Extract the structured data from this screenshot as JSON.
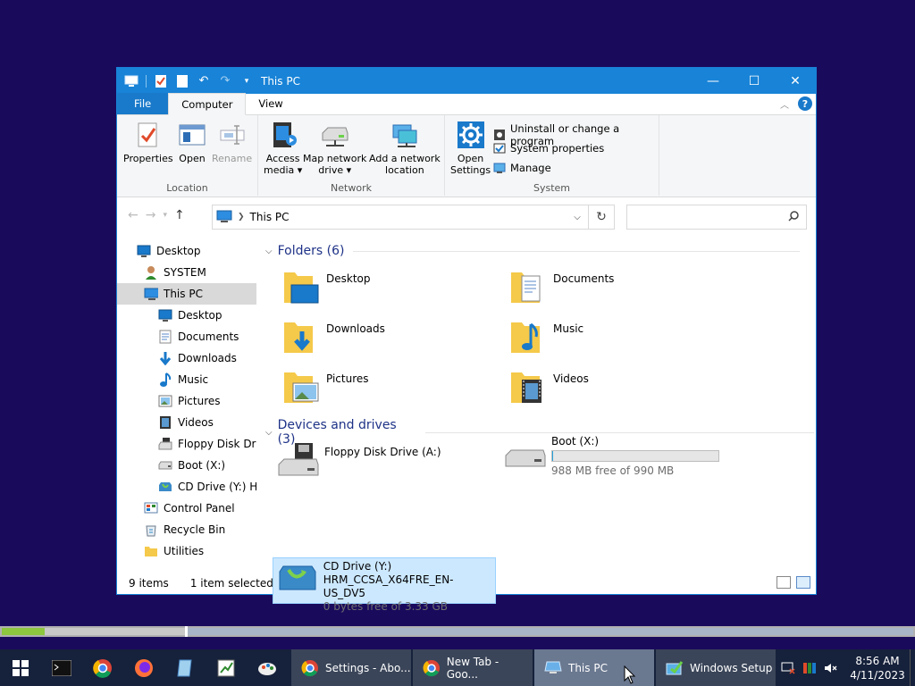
{
  "window": {
    "title": "This PC",
    "controls": {
      "minimize": "—",
      "maximize": "☐",
      "close": "✕"
    }
  },
  "ribbon": {
    "tabs": [
      "File",
      "Computer",
      "View"
    ],
    "active_tab": "Computer",
    "groups": {
      "location": {
        "label": "Location",
        "buttons": [
          "Properties",
          "Open",
          "Rename"
        ]
      },
      "network": {
        "label": "Network",
        "access_media": [
          "Access",
          "media ▾"
        ],
        "map_drive": [
          "Map network",
          "drive ▾"
        ],
        "add_location": [
          "Add a network",
          "location"
        ]
      },
      "system": {
        "label": "System",
        "open_settings": [
          "Open",
          "Settings"
        ],
        "uninstall": "Uninstall or change a program",
        "system_properties": "System properties",
        "manage": "Manage"
      }
    }
  },
  "address": {
    "crumb": "This PC",
    "search_placeholder": ""
  },
  "navpane": {
    "items": [
      {
        "label": "Desktop",
        "indent": 0,
        "icon": "desktop-icon"
      },
      {
        "label": "SYSTEM",
        "indent": 1,
        "icon": "user-icon"
      },
      {
        "label": "This PC",
        "indent": 1,
        "icon": "pc-icon",
        "selected": true
      },
      {
        "label": "Desktop",
        "indent": 2,
        "icon": "desktop-icon"
      },
      {
        "label": "Documents",
        "indent": 2,
        "icon": "documents-icon"
      },
      {
        "label": "Downloads",
        "indent": 2,
        "icon": "downloads-icon"
      },
      {
        "label": "Music",
        "indent": 2,
        "icon": "music-icon"
      },
      {
        "label": "Pictures",
        "indent": 2,
        "icon": "pictures-icon"
      },
      {
        "label": "Videos",
        "indent": 2,
        "icon": "videos-icon"
      },
      {
        "label": "Floppy Disk Drive",
        "indent": 2,
        "icon": "floppy-icon"
      },
      {
        "label": "Boot (X:)",
        "indent": 2,
        "icon": "drive-icon"
      },
      {
        "label": "CD Drive (Y:) HRM",
        "indent": 2,
        "icon": "cd-icon"
      },
      {
        "label": "Control Panel",
        "indent": 1,
        "icon": "control-panel-icon"
      },
      {
        "label": "Recycle Bin",
        "indent": 1,
        "icon": "recycle-bin-icon"
      },
      {
        "label": "Utilities",
        "indent": 1,
        "icon": "folder-icon"
      }
    ]
  },
  "content": {
    "folders_header": "Folders (6)",
    "folders": [
      "Desktop",
      "Documents",
      "Downloads",
      "Music",
      "Pictures",
      "Videos"
    ],
    "devices_header": "Devices and drives (3)",
    "floppy": {
      "name": "Floppy Disk Drive (A:)"
    },
    "boot": {
      "name": "Boot (X:)",
      "free": "988 MB free of 990 MB",
      "used_fraction": 0.002
    },
    "cd": {
      "name": "CD Drive (Y:)",
      "label": "HRM_CCSA_X64FRE_EN-US_DV5",
      "free": "0 bytes free of 3.33 GB"
    }
  },
  "status": {
    "items": "9 items",
    "selected": "1 item selected"
  },
  "taskbar": {
    "apps": [
      {
        "label": "Settings - Abo...",
        "icon": "chrome-icon"
      },
      {
        "label": "New Tab - Goo...",
        "icon": "chrome-icon"
      },
      {
        "label": "This PC",
        "icon": "pc-icon",
        "active": true
      },
      {
        "label": "Windows Setup",
        "icon": "setup-icon"
      }
    ],
    "clock": {
      "time": "8:56 AM",
      "date": "4/11/2023"
    }
  },
  "colors": {
    "accent": "#1883d7",
    "desktop": "#1a0a5c",
    "taskbar": "#16213b",
    "folder": "#f5c94a"
  }
}
